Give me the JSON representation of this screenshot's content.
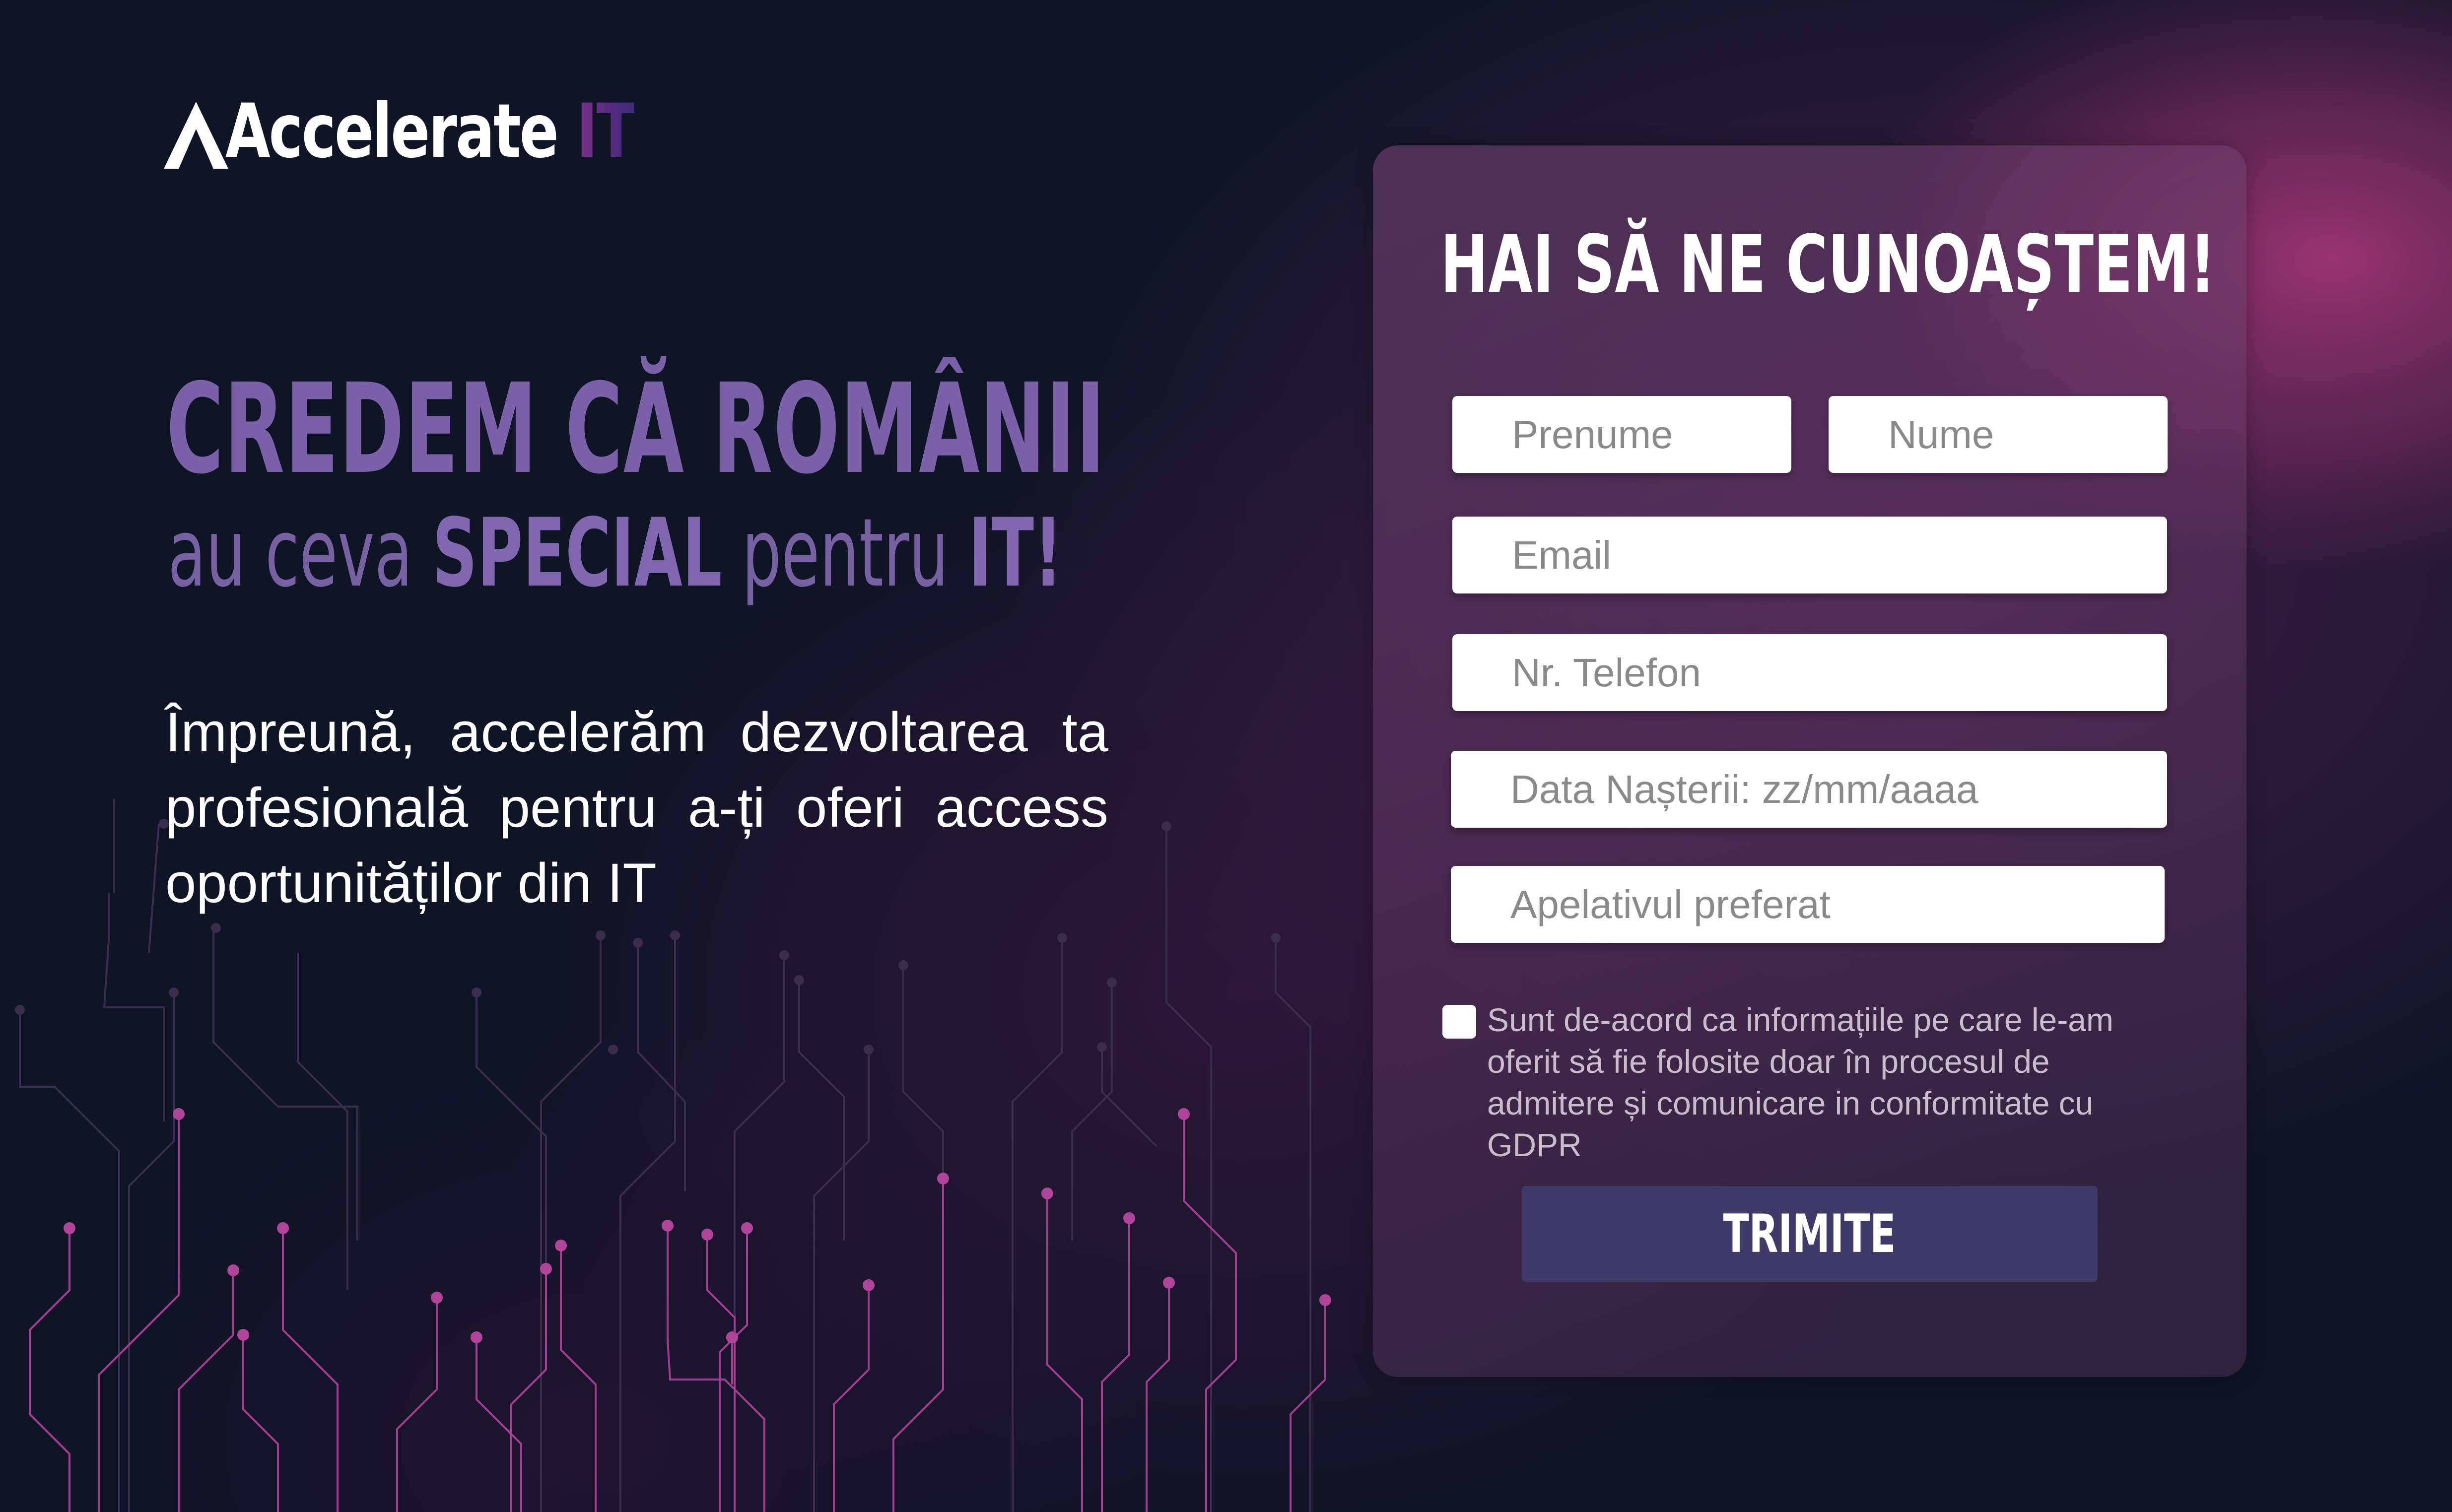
{
  "brand": {
    "logo_text": "Accelerate",
    "logo_suffix": "IT",
    "logo_icon": "triangle-a-icon"
  },
  "hero": {
    "title": "CREDEM CĂ ROMÂNII",
    "subtitle_part1": "au ceva ",
    "subtitle_bold1": "SPECIAL",
    "subtitle_part2": " pentru ",
    "subtitle_bold2": "IT!",
    "description": "Împreună, accelerăm dezvoltarea ta profesională pentru a-ți oferi access oportunităților din IT"
  },
  "form": {
    "title": "HAI SĂ NE CUNOAȘTEM!",
    "first_name_placeholder": "Prenume",
    "last_name_placeholder": "Nume",
    "email_placeholder": "Email",
    "phone_placeholder": "Nr. Telefon",
    "birthdate_placeholder": "Data Nașterii: zz/mm/aaaa",
    "salutation_placeholder": "Apelativul preferat",
    "consent_text": "Sunt de-acord ca informațiile pe care le-am oferit să fie folosite doar în procesul de admitere și comunicare in conformitate cu GDPR",
    "consent_checked": false,
    "submit_label": "TRIMITE"
  },
  "colors": {
    "background": "#0f1426",
    "accent_purple": "#7b62a8",
    "button": "#403a69",
    "glow_pink": "#be3c82",
    "circuit_dim": "#3a2e4c",
    "circuit_bright": "#b0449a"
  }
}
